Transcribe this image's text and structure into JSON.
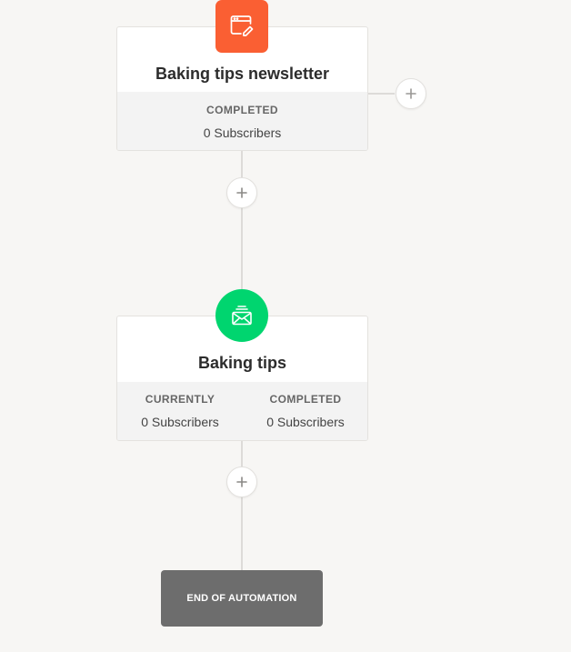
{
  "colors": {
    "background": "#f7f6f4",
    "form_icon": "#fa5f33",
    "email_icon": "#00d56f",
    "end_box": "#6d6d6d"
  },
  "steps": [
    {
      "title": "Baking tips newsletter",
      "icon": "form-icon",
      "stats": [
        {
          "label": "COMPLETED",
          "value": "0 Subscribers"
        }
      ]
    },
    {
      "title": "Baking tips",
      "icon": "email-sequence-icon",
      "stats": [
        {
          "label": "CURRENTLY",
          "value": "0 Subscribers"
        },
        {
          "label": "COMPLETED",
          "value": "0 Subscribers"
        }
      ]
    }
  ],
  "end": {
    "label": "END OF AUTOMATION"
  },
  "controls": {
    "add_icon": "plus-icon"
  }
}
